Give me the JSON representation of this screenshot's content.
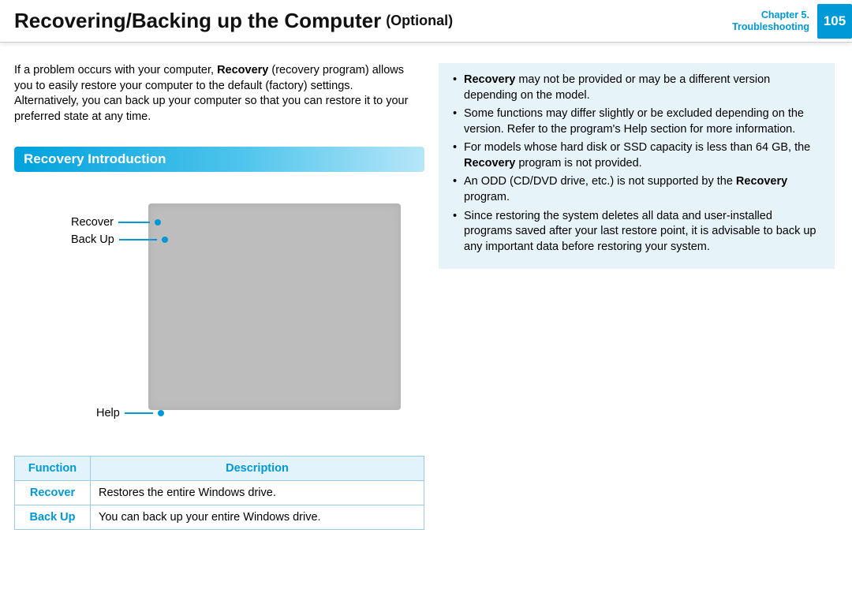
{
  "header": {
    "title": "Recovering/Backing up the Computer",
    "optional": "(Optional)",
    "chapter_line1": "Chapter 5.",
    "chapter_line2": "Troubleshooting",
    "page": "105"
  },
  "intro": {
    "p1a": "If a problem occurs with your computer, ",
    "p1b": "Recovery",
    "p1c": " (recovery program) allows you to easily restore your computer to the default (factory) settings. Alternatively, you can back up your computer so that you can restore it to your preferred state at any time."
  },
  "section": {
    "title": "Recovery Introduction"
  },
  "callouts": {
    "recover": "Recover",
    "backup": "Back Up",
    "help": "Help"
  },
  "table": {
    "head_function": "Function",
    "head_description": "Description",
    "rows": [
      {
        "fn": "Recover",
        "desc": "Restores the entire Windows drive."
      },
      {
        "fn": "Back Up",
        "desc": "You can back up your entire Windows drive."
      }
    ]
  },
  "notes": {
    "i0a": "Recovery",
    "i0b": " may not be provided or may be a different version depending on the model.",
    "i1": "Some functions may differ slightly or be excluded depending on the version. Refer to the program's Help section for more information.",
    "i2a": "For models whose hard disk or SSD capacity is less than 64 GB, the ",
    "i2b": "Recovery",
    "i2c": " program is not provided.",
    "i3a": "An ODD (CD/DVD drive, etc.) is not supported by the ",
    "i3b": "Recovery",
    "i3c": " program.",
    "i4": "Since restoring the system deletes all data and user-installed programs saved after your last restore point, it is advisable to back up any important data before restoring your system."
  }
}
